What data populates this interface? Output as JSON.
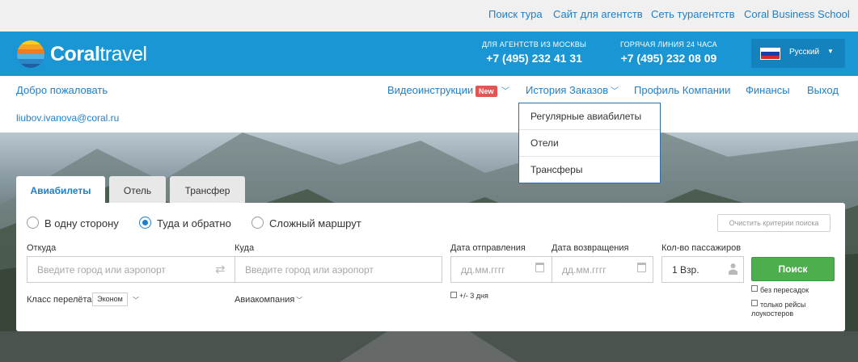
{
  "top_links": [
    "Поиск тура",
    "Сайт для агентств",
    "Сеть турагентств",
    "Coral Business School"
  ],
  "header": {
    "logo_bold": "Coral",
    "logo_light": "travel",
    "moscow": {
      "caption": "ДЛЯ АГЕНТСТВ ИЗ МОСКВЫ",
      "phone": "+7 (495) 232 41 31"
    },
    "hotline": {
      "caption": "ГОРЯЧАЯ ЛИНИЯ 24 ЧАСА",
      "phone": "+7 (495) 232 08 09"
    },
    "language": "Русский"
  },
  "nav": {
    "welcome": "Добро пожаловать",
    "email": "liubov.ivanova@coral.ru",
    "video": "Видеоинструкции",
    "new_badge": "New",
    "orders": "История Заказов",
    "profile": "Профиль Компании",
    "finance": "Финансы",
    "logout": "Выход"
  },
  "dropdown": [
    "Регулярные авиабилеты",
    "Отели",
    "Трансферы"
  ],
  "tabs": [
    "Авиабилеты",
    "Отель",
    "Трансфер"
  ],
  "trip_types": [
    "В одну сторону",
    "Туда и обратно",
    "Сложный маршрут"
  ],
  "selected_trip_type": "Туда и обратно",
  "clear_label": "Очистить критерии поиска",
  "fields": {
    "from_label": "Откуда",
    "from_placeholder": "Введите город или аэропорт",
    "to_label": "Куда",
    "to_placeholder": "Введите город или аэропорт",
    "depart_label": "Дата отправления",
    "depart_placeholder": "дд.мм.гггг",
    "return_label": "Дата возвращения",
    "return_placeholder": "дд.мм.гггг",
    "pax_label": "Кол-во пассажиров",
    "pax_value": "1 Взр."
  },
  "search_button": "Поиск",
  "flex_dates": "+/- 3 дня",
  "class_label": "Класс перелёта",
  "class_value": "Эконом",
  "airline_label": "Авиакомпания",
  "no_transfers": "без пересадок",
  "lowcost_line1": "только рейсы",
  "lowcost_line2": "лоукостеров",
  "colors": {
    "header_blue": "#1a96d4",
    "link_blue": "#1f7fc9",
    "search_green": "#4cae4c",
    "badge_red": "#e25555"
  }
}
